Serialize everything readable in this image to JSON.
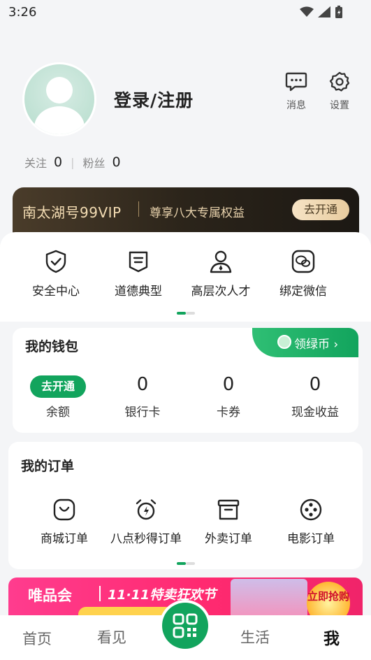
{
  "status": {
    "time": "3:26"
  },
  "profile": {
    "login_label": "登录/注册"
  },
  "top_actions": [
    {
      "label": "消息",
      "icon": "message-icon"
    },
    {
      "label": "设置",
      "icon": "gear-icon"
    }
  ],
  "follow": {
    "following_label": "关注",
    "following_count": "0",
    "fans_label": "粉丝",
    "fans_count": "0"
  },
  "vip": {
    "title": "南太湖号99VIP",
    "subtitle": "尊享八大专属权益",
    "button": "去开通"
  },
  "quick": [
    {
      "label": "安全中心",
      "icon": "shield-check-icon"
    },
    {
      "label": "道德典型",
      "icon": "badge-icon"
    },
    {
      "label": "高层次人才",
      "icon": "person-icon"
    },
    {
      "label": "绑定微信",
      "icon": "wechat-icon"
    }
  ],
  "wallet": {
    "title": "我的钱包",
    "coin_label": "领绿币 ›",
    "open_label": "去开通",
    "items": [
      {
        "value": "",
        "label": "余额"
      },
      {
        "value": "0",
        "label": "银行卡"
      },
      {
        "value": "0",
        "label": "卡券"
      },
      {
        "value": "0",
        "label": "现金收益"
      }
    ]
  },
  "orders": {
    "title": "我的订单",
    "items": [
      {
        "label": "商城订单",
        "icon": "shopping-bag-icon"
      },
      {
        "label": "八点秒得订单",
        "icon": "alarm-clock-icon"
      },
      {
        "label": "外卖订单",
        "icon": "takeout-box-icon"
      },
      {
        "label": "电影订单",
        "icon": "film-reel-icon"
      }
    ]
  },
  "ad": {
    "brand": "唯品会",
    "slogan": "11·11特卖狂欢节",
    "button": "立即抢购"
  },
  "tabs": [
    {
      "label": "首页"
    },
    {
      "label": "看见"
    },
    {
      "label": "生活"
    },
    {
      "label": "我"
    }
  ],
  "colors": {
    "accent": "#12a45d",
    "vip_gold": "#f3dcb3",
    "ad_pink": "#ff2a70"
  }
}
